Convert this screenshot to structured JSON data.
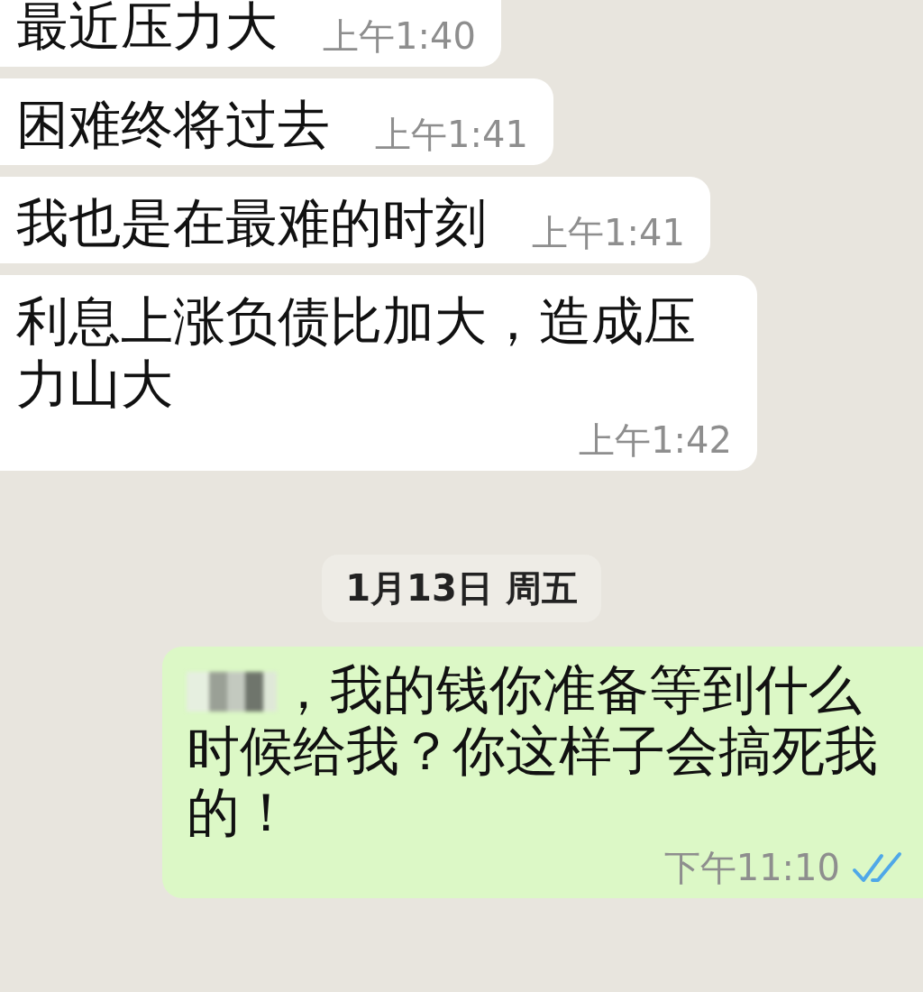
{
  "items": [
    {
      "kind": "incoming",
      "text": "最近压力大",
      "time": "上午1:40"
    },
    {
      "kind": "incoming",
      "text": "困难终将过去",
      "time": "上午1:41"
    },
    {
      "kind": "incoming",
      "text": "我也是在最难的时刻",
      "time": "上午1:41"
    },
    {
      "kind": "incoming",
      "text": "利息上涨负债比加大，造成压力山大",
      "time": "上午1:42"
    },
    {
      "kind": "date",
      "text": "1月13日 周五"
    },
    {
      "kind": "outgoing",
      "redacted": true,
      "text": "，我的钱你准备等到什么时候给我？你这样子会搞死我的！",
      "time": "下午11:10",
      "read": true
    }
  ]
}
